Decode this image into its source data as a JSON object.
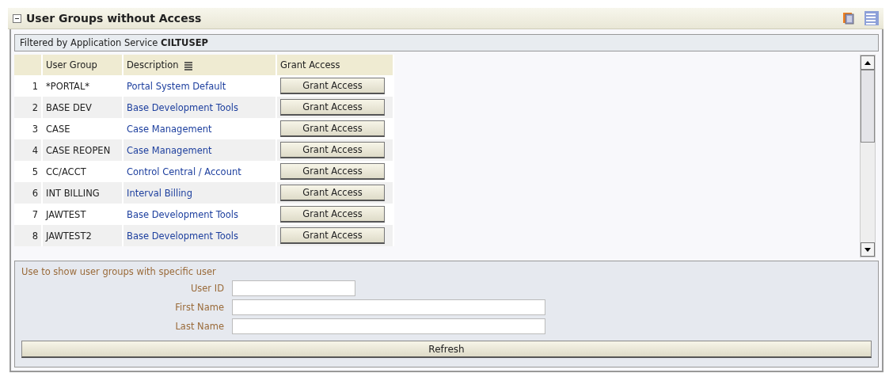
{
  "title": "User Groups without Access",
  "filter": {
    "label": "Filtered by Application Service",
    "value": "CILTUSEP"
  },
  "columns": [
    "User Group",
    "Description",
    "Grant Access"
  ],
  "rows": [
    {
      "number": "1",
      "user_group": "*PORTAL*",
      "description": "Portal System Default",
      "action": "Grant Access"
    },
    {
      "number": "2",
      "user_group": "BASE DEV",
      "description": "Base Development Tools",
      "action": "Grant Access"
    },
    {
      "number": "3",
      "user_group": "CASE",
      "description": "Case Management",
      "action": "Grant Access"
    },
    {
      "number": "4",
      "user_group": "CASE REOPEN",
      "description": "Case Management",
      "action": "Grant Access"
    },
    {
      "number": "5",
      "user_group": "CC/ACCT",
      "description": "Control Central / Account",
      "action": "Grant Access"
    },
    {
      "number": "6",
      "user_group": "INT BILLING",
      "description": "Interval Billing",
      "action": "Grant Access"
    },
    {
      "number": "7",
      "user_group": "JAWTEST",
      "description": "Base Development Tools",
      "action": "Grant Access"
    },
    {
      "number": "8",
      "user_group": "JAWTEST2",
      "description": "Base Development Tools",
      "action": "Grant Access"
    }
  ],
  "form": {
    "hint": "Use to show user groups with specific user",
    "fields": [
      {
        "label": "User ID",
        "kind": "short"
      },
      {
        "label": "First Name",
        "kind": "long"
      },
      {
        "label": "Last Name",
        "kind": "long"
      }
    ],
    "button": "Refresh"
  }
}
